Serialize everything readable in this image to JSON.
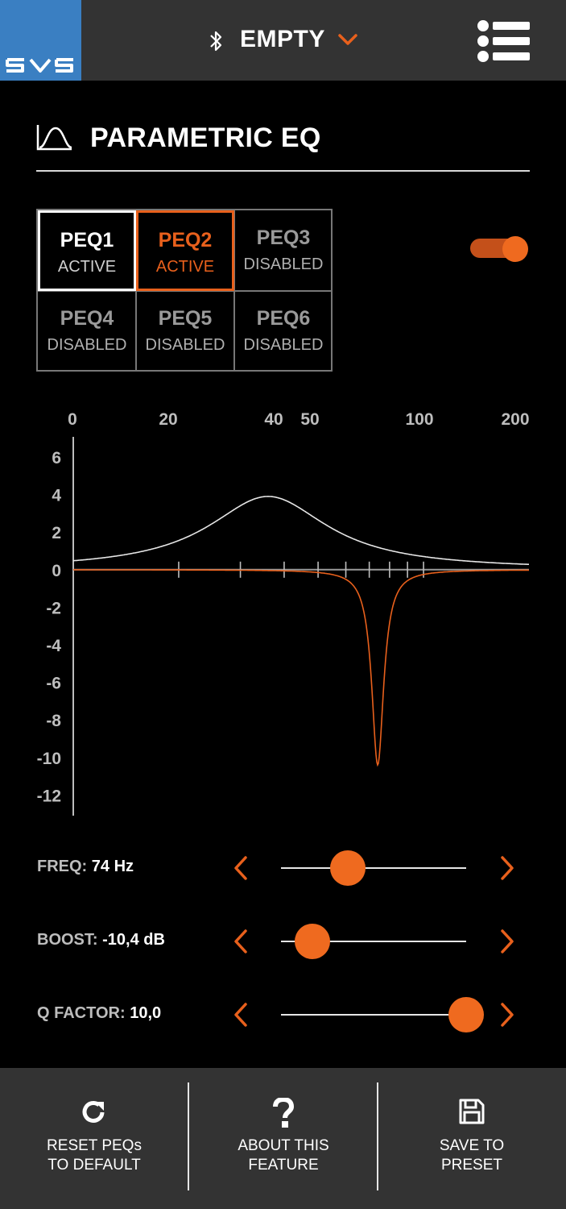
{
  "app": {
    "logo_text": "SVS",
    "preset_name": "EMPTY",
    "icons": {
      "bluetooth": "bluetooth-icon",
      "dropdown": "chevron-down-icon",
      "menu": "menu-list-icon"
    }
  },
  "header": {
    "title": "PARAMETRIC EQ",
    "icon": "eq-curve-icon"
  },
  "peq": {
    "enabled": true,
    "items": [
      {
        "name": "PEQ1",
        "status": "ACTIVE"
      },
      {
        "name": "PEQ2",
        "status": "ACTIVE"
      },
      {
        "name": "PEQ3",
        "status": "DISABLED"
      },
      {
        "name": "PEQ4",
        "status": "DISABLED"
      },
      {
        "name": "PEQ5",
        "status": "DISABLED"
      },
      {
        "name": "PEQ6",
        "status": "DISABLED"
      }
    ]
  },
  "chart_data": {
    "type": "line",
    "x_tick_labels": [
      "0",
      "20",
      "40",
      "50",
      "100",
      "200"
    ],
    "y_tick_labels": [
      "6",
      "4",
      "2",
      "0",
      "-2",
      "-4",
      "-6",
      "-8",
      "-10",
      "-12"
    ],
    "ylim": [
      -12,
      6
    ],
    "xlim": [
      10,
      200
    ],
    "x_scale": "log",
    "series": [
      {
        "color": "#e6e6e6",
        "peak_freq": 36,
        "peak_gain": 3.9,
        "q": 1.0
      },
      {
        "color": "#e8601c",
        "peak_freq": 74,
        "peak_gain": -10.4,
        "q": 10.0
      }
    ]
  },
  "sliders": [
    {
      "label": "FREQ:",
      "value": "74 Hz",
      "level": 0.3
    },
    {
      "label": "BOOST:",
      "value": "-10,4 dB",
      "level": 0.09
    },
    {
      "label": "Q FACTOR:",
      "value": "10,0",
      "level": 1.0
    }
  ],
  "footer": {
    "reset": {
      "line1": "RESET PEQs",
      "line2": "TO DEFAULT",
      "icon": "refresh-icon"
    },
    "about": {
      "line1": "ABOUT THIS",
      "line2": "FEATURE",
      "icon": "question-icon"
    },
    "save": {
      "line1": "SAVE TO",
      "line2": "PRESET",
      "icon": "save-icon"
    }
  },
  "colors": {
    "accent": "#e8601c",
    "topbar": "#333333",
    "logo_bg": "#3a7fc2"
  }
}
